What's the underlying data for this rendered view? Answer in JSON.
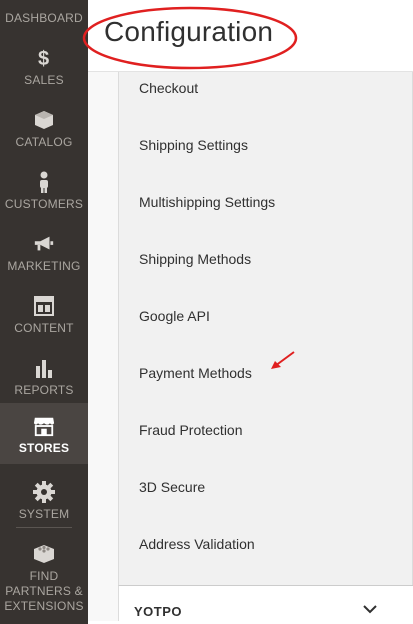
{
  "nav": {
    "items": [
      {
        "label": "DASHBOARD",
        "icon": "dashboard-icon"
      },
      {
        "label": "SALES",
        "icon": "dollar-icon"
      },
      {
        "label": "CATALOG",
        "icon": "box-icon"
      },
      {
        "label": "CUSTOMERS",
        "icon": "person-icon"
      },
      {
        "label": "MARKETING",
        "icon": "megaphone-icon"
      },
      {
        "label": "CONTENT",
        "icon": "layout-icon"
      },
      {
        "label": "REPORTS",
        "icon": "bar-chart-icon"
      },
      {
        "label": "STORES",
        "icon": "storefront-icon"
      },
      {
        "label": "SYSTEM",
        "icon": "gear-icon"
      },
      {
        "label": "FIND PARTNERS & EXTENSIONS",
        "icon": "blocks-icon"
      }
    ],
    "active": "STORES"
  },
  "header": {
    "title": "Configuration"
  },
  "config_tree": {
    "items": [
      {
        "label": "Checkout"
      },
      {
        "label": "Shipping Settings"
      },
      {
        "label": "Multishipping Settings"
      },
      {
        "label": "Shipping Methods"
      },
      {
        "label": "Google API"
      },
      {
        "label": "Payment Methods"
      },
      {
        "label": "Fraud Protection"
      },
      {
        "label": "3D Secure"
      },
      {
        "label": "Address Validation"
      }
    ]
  },
  "sections": [
    {
      "title": "YOTPO",
      "icon": "chevron-down-icon"
    }
  ],
  "colors": {
    "nav_bg": "#373330",
    "nav_active_bg": "#4a4542",
    "annotation_red": "#e02020"
  }
}
